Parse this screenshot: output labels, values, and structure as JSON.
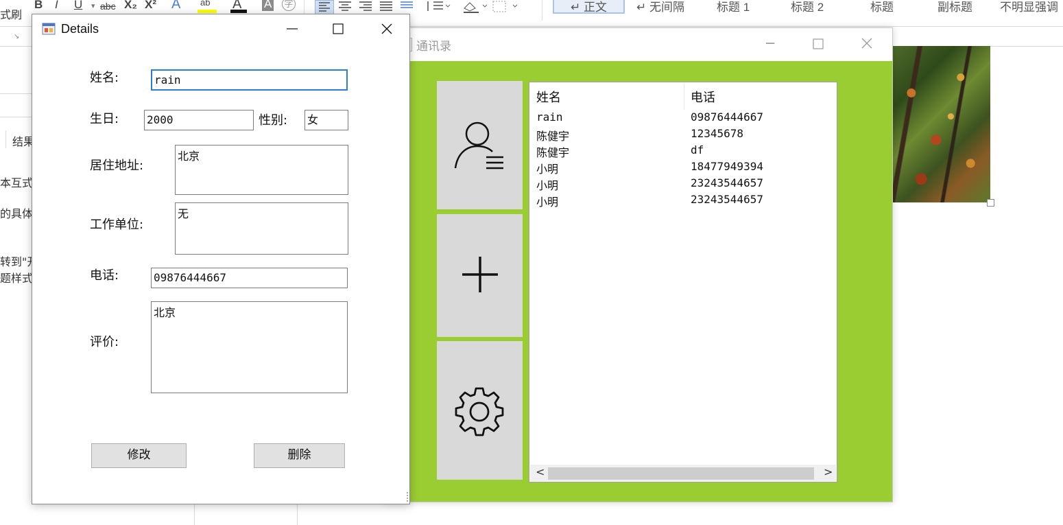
{
  "word": {
    "ribbon_left_label": "式刷",
    "toolbar_glyphs": {
      "bold": "B",
      "italic": "I",
      "underline": "U",
      "strike": "abc",
      "subscript": "X₂",
      "superscript": "X²",
      "text_effect": "A",
      "highlight": "ab",
      "font_color": "A",
      "char_shading": "A",
      "enclose": "字"
    },
    "styles": [
      "↵ 正文",
      "↵ 无间隔",
      "标题 1",
      "标题 2",
      "标题",
      "副标题",
      "不明显强调"
    ],
    "doc_fragments": [
      "结果",
      "本互式力",
      "的具体位",
      "转到\"开",
      "题样式。"
    ]
  },
  "address_book": {
    "title": "通讯录",
    "nav": [
      {
        "name": "contacts",
        "icon": "contacts-list-icon"
      },
      {
        "name": "add",
        "icon": "plus-icon"
      },
      {
        "name": "settings",
        "icon": "gear-icon"
      }
    ],
    "columns": [
      "姓名",
      "电话"
    ],
    "rows": [
      {
        "name": "rain",
        "phone": "09876444667"
      },
      {
        "name": "陈健宇",
        "phone": "12345678"
      },
      {
        "name": "陈健宇",
        "phone": "df"
      },
      {
        "name": "小明",
        "phone": "18477949394"
      },
      {
        "name": "小明",
        "phone": "23243544657"
      },
      {
        "name": "小明",
        "phone": "23243544657"
      }
    ],
    "scroll_left": "<",
    "scroll_right": ">"
  },
  "details": {
    "title": "Details",
    "labels": {
      "name": "姓名:",
      "birthday": "生日:",
      "gender": "性别:",
      "address": "居住地址:",
      "work": "工作单位:",
      "phone": "电话:",
      "comment": "评价:"
    },
    "values": {
      "name": "rain",
      "birthday": "2000",
      "gender": "女",
      "address": "北京",
      "work": "无",
      "phone": "09876444667",
      "comment": "北京"
    },
    "buttons": {
      "modify": "修改",
      "delete": "删除"
    }
  },
  "colors": {
    "app_background": "#9acd32",
    "nav_button": "#d9d9d9",
    "focus_border": "#2b7bd8"
  }
}
